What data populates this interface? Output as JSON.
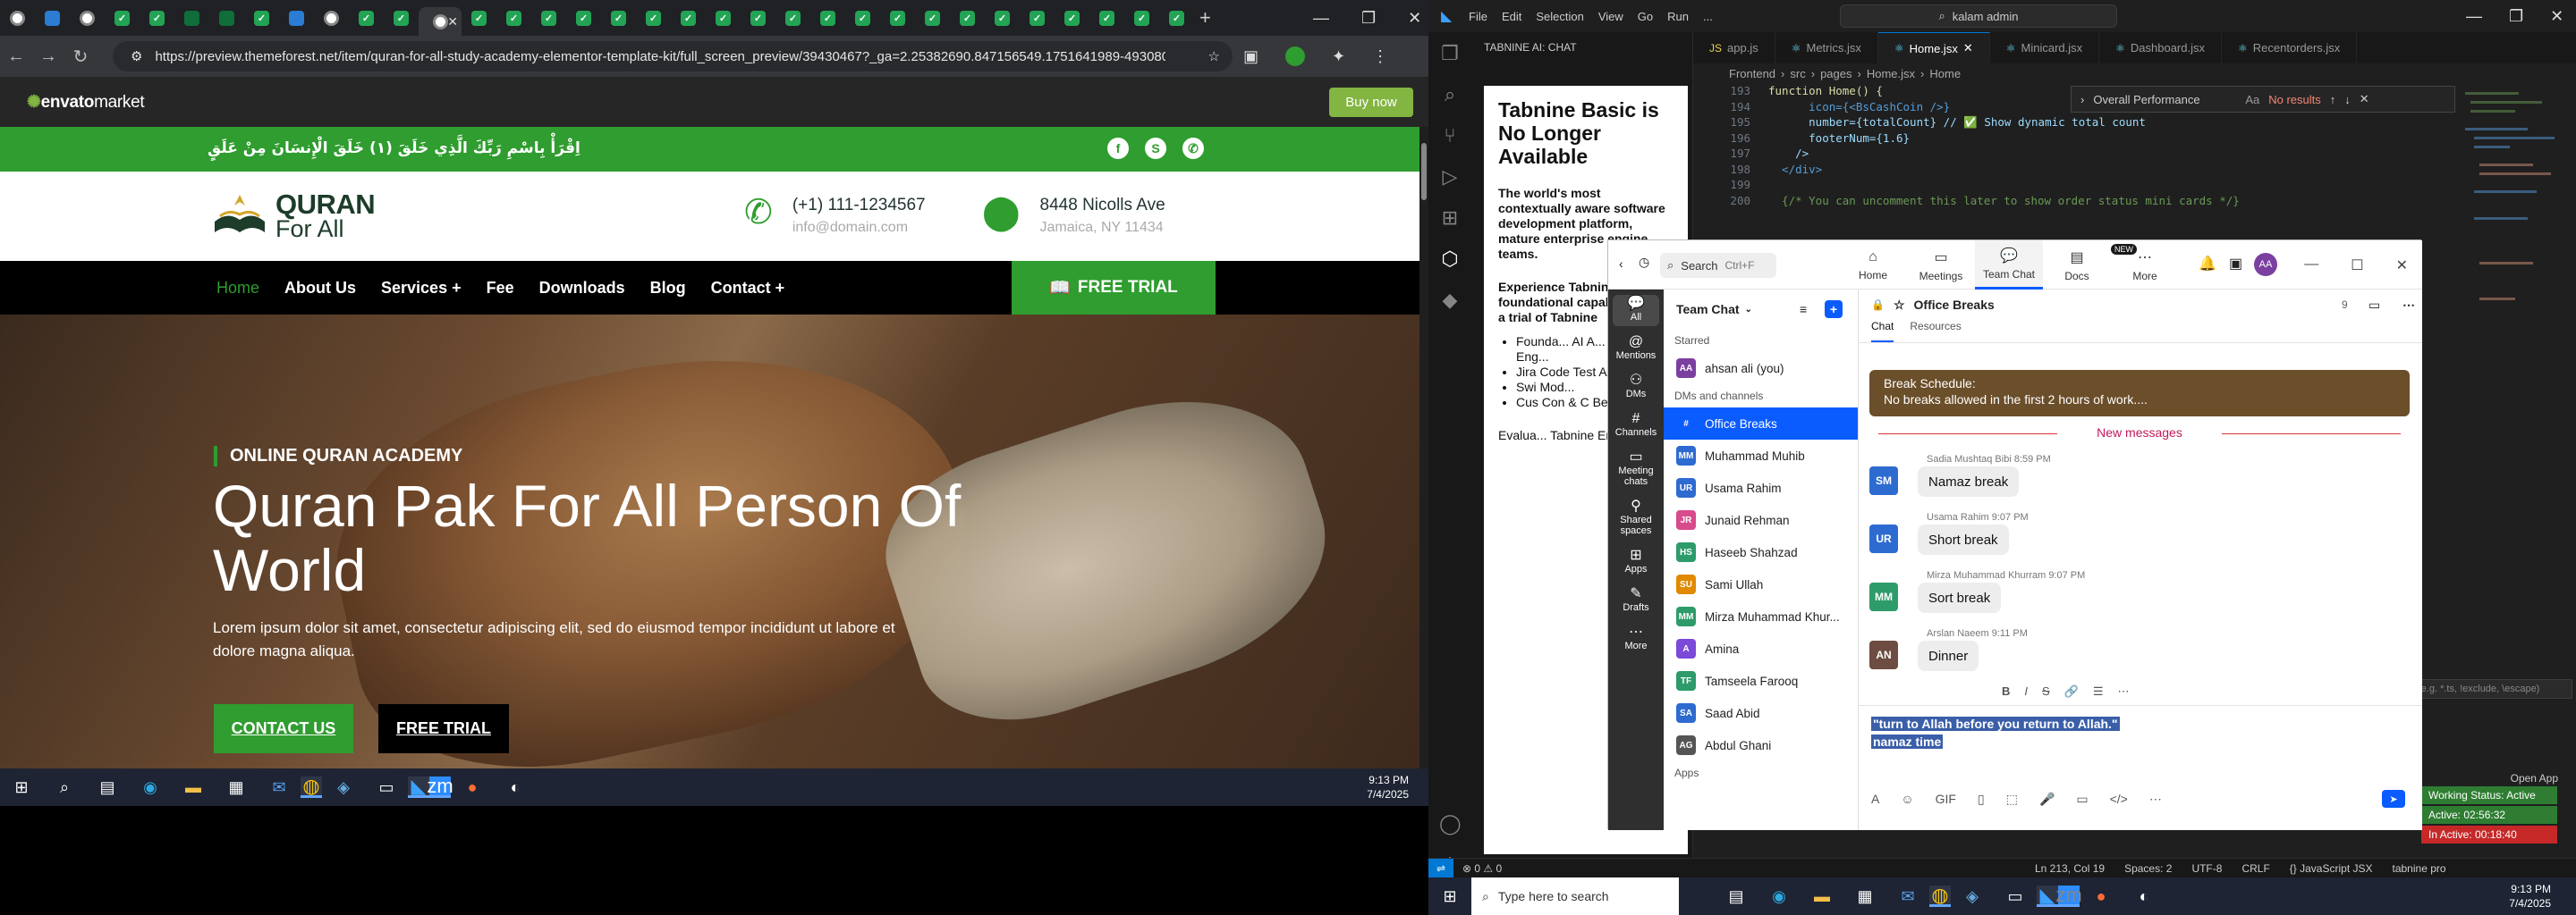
{
  "browser": {
    "tab_count": 34,
    "url": "https://preview.themeforest.net/item/quran-for-all-study-academy-elementor-template-kit/full_screen_preview/39430467?_ga=2.25382690.847156549.1751641989-493080941.1751641989&_gac=..."
  },
  "envato": {
    "logo_text": "envato",
    "logo_suffix": "market",
    "buy_label": "Buy now"
  },
  "site": {
    "arabic_text": "اِقْرَأْ بِاسْمِ رَبِّكَ الَّذِي خَلَقَ (١) خَلَقَ الْإِنسَانَ مِنْ عَلَقٍ",
    "brand_line1": "QURAN",
    "brand_line2": "For All",
    "phone": "(+1) 111-1234567",
    "email": "info@domain.com",
    "address1": "8448 Nicolls Ave",
    "address2": "Jamaica, NY 11434",
    "nav": [
      "Home",
      "About Us",
      "Services +",
      "Fee",
      "Downloads",
      "Blog",
      "Contact +"
    ],
    "free_trial": "FREE TRIAL",
    "hero_label": "ONLINE QURAN ACADEMY",
    "hero_title": "Quran Pak For All Person Of World",
    "hero_desc": "Lorem ipsum dolor sit amet, consectetur adipiscing elit, sed do eiusmod tempor incididunt ut labore et dolore magna aliqua.",
    "btn_contact": "CONTACT US",
    "btn_trial": "FREE TRIAL"
  },
  "taskbar_left": {
    "time": "9:13 PM",
    "date": "7/4/2025"
  },
  "vscode": {
    "menu": [
      "File",
      "Edit",
      "Selection",
      "View",
      "Go",
      "Run",
      "..."
    ],
    "search": "kalam admin",
    "panel_title": "TABNINE AI: CHAT",
    "tabnine_heading": "Tabnine Basic is No Longer Available",
    "tabnine_p1": "The world's most contextually aware software development platform, mature enterprise engine teams.",
    "tabnine_p2": "Experience Tabnine's foundational capabilities with a trial of Tabnine",
    "tabnine_list": [
      "Founda... AI A... and Com... Eng...",
      "Jira Code Test Age...",
      "Swi Mod...",
      "Cus Con & C Beh..."
    ],
    "tabnine_footer": "Evalua... Tabnine Enterprise:",
    "tabs": [
      "app.js",
      "Metrics.jsx",
      "Home.jsx",
      "Minicard.jsx",
      "Dashboard.jsx",
      "Recentorders.jsx"
    ],
    "breadcrumb": [
      "Frontend",
      "src",
      "pages",
      "Home.jsx",
      "Home"
    ],
    "find_text": "Overall Performance",
    "find_result": "No results",
    "code_lines": [
      {
        "n": "194",
        "t": "      icon={<BsCashCoin />}"
      },
      {
        "n": "195",
        "t": "      number={totalCount} // ✅ Show dynamic total count"
      },
      {
        "n": "196",
        "t": "      footerNum={1.6}"
      },
      {
        "n": "197",
        "t": "    />"
      },
      {
        "n": "198",
        "t": "  </div>"
      },
      {
        "n": "199",
        "t": ""
      },
      {
        "n": "200",
        "t": "  {/* You can uncomment this later to show order status mini cards */}"
      }
    ],
    "function_line": "function Home() {",
    "status_left": "⊗ 0 ⚠ 0",
    "status_right": [
      "Ln 213, Col 19",
      "Spaces: 2",
      "UTF-8",
      "CRLF",
      "{} JavaScript JSX",
      "tabnine pro"
    ],
    "panel_search_placeholder": "(e.g. *.ts, !exclude, \\escape)",
    "open_app": "Open App",
    "badges": [
      {
        "label": "Working Status: Active",
        "color": "#2e7d32"
      },
      {
        "label": "Active: 02:56:32",
        "color": "#2e7d32"
      },
      {
        "label": "In Active: 00:18:40",
        "color": "#c62828"
      }
    ]
  },
  "zoom": {
    "search": "Search",
    "search_key": "Ctrl+F",
    "top_tabs": [
      "Home",
      "Meetings",
      "Team Chat",
      "Docs",
      "More"
    ],
    "new_badge": "NEW",
    "rail": [
      "All",
      "Mentions",
      "DMs",
      "Channels",
      "Meeting chats",
      "Shared spaces",
      "Apps",
      "Drafts",
      "More"
    ],
    "list_title": "Team Chat",
    "starred": "Starred",
    "me": "ahsan ali (you)",
    "dms_channels": "DMs and channels",
    "contacts": [
      {
        "name": "Office Breaks",
        "initials": "#",
        "color": "#0b5cff"
      },
      {
        "name": "Muhammad Muhib",
        "initials": "MM",
        "color": "#2e6bd1"
      },
      {
        "name": "Usama Rahim",
        "initials": "UR",
        "color": "#2e6bd1"
      },
      {
        "name": "Junaid Rehman",
        "initials": "JR",
        "color": "#d84b8c"
      },
      {
        "name": "Haseeb Shahzad",
        "initials": "HS",
        "color": "#2e9b6a"
      },
      {
        "name": "Sami Ullah",
        "initials": "SU",
        "color": "#e08a00"
      },
      {
        "name": "Mirza Muhammad Khur...",
        "initials": "MM",
        "color": "#2e9b6a"
      },
      {
        "name": "Amina",
        "initials": "A",
        "color": "#7b4ad8"
      },
      {
        "name": "Tamseela Farooq",
        "initials": "TF",
        "color": "#2e9b6a"
      },
      {
        "name": "Saad Abid",
        "initials": "SA",
        "color": "#2e6bd1"
      },
      {
        "name": "Abdul Ghani",
        "initials": "AG",
        "color": "#555"
      }
    ],
    "apps": "Apps",
    "channel": "Office Breaks",
    "channel_members": "9",
    "chat_tabs": [
      "Chat",
      "Resources"
    ],
    "pinned_title": "Break Schedule:",
    "pinned_text": "No breaks allowed in the first 2 hours of work....",
    "new_messages": "New messages",
    "messages": [
      {
        "meta": "Sadia Mushtaq Bibi 8:59 PM",
        "initials": "SM",
        "color": "#2e6bd1",
        "text": "Namaz break"
      },
      {
        "meta": "Usama Rahim 9:07 PM",
        "initials": "UR",
        "color": "#2e6bd1",
        "text": "Short break"
      },
      {
        "meta": "Mirza Muhammad Khurram 9:07 PM",
        "initials": "MM",
        "color": "#2e9b6a",
        "text": "Sort break"
      },
      {
        "meta": "Arslan Naeem 9:11 PM",
        "initials": "AN",
        "color": "#6d4c41",
        "text": "Dinner"
      }
    ],
    "compose_line1": "\"turn to Allah before you return to Allah.\"",
    "compose_line2": "namaz time"
  },
  "taskbar_right": {
    "search_placeholder": "Type here to search",
    "time": "9:13 PM",
    "date": "7/4/2025"
  }
}
